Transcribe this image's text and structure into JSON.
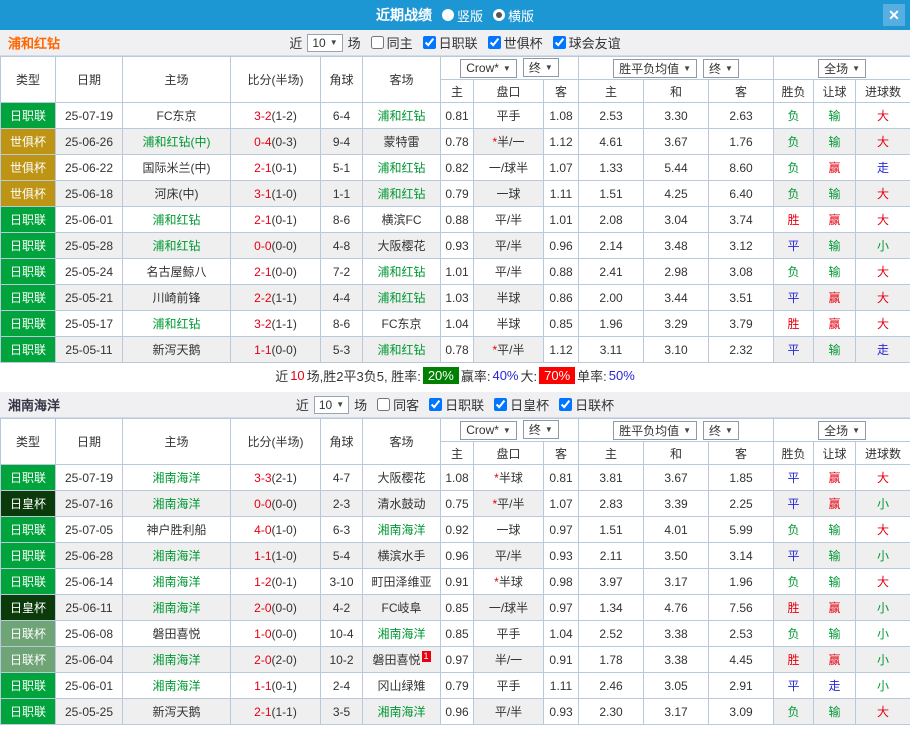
{
  "titlebar": {
    "title": "近期战绩",
    "radios": [
      {
        "label": "竖版",
        "selected": false
      },
      {
        "label": "横版",
        "selected": true
      }
    ],
    "close_icon": "✕"
  },
  "league_colors": {
    "日职联": "#00a33c",
    "世俱杯": "#bd9414",
    "日皇杯": "#0b3b0b",
    "日联杯": "#6fa477"
  },
  "columns": {
    "main": [
      "类型",
      "日期",
      "主场",
      "比分(半场)",
      "角球",
      "客场"
    ],
    "sub": [
      "主",
      "盘口",
      "客",
      "主",
      "和",
      "客",
      "胜负",
      "让球",
      "进球数"
    ],
    "selects": {
      "bookmaker": "Crow*",
      "final1": "终",
      "odds_avg": "胜平负均值",
      "final2": "终",
      "scope": "全场"
    }
  },
  "tables": [
    {
      "team": "浦和红钻",
      "team_color": "#ff6600",
      "filter": {
        "prefix": "近",
        "count": "10",
        "suffix": "场",
        "same_label": "同主",
        "same_checked": false,
        "leagues": [
          {
            "label": "日职联",
            "checked": true
          },
          {
            "label": "世俱杯",
            "checked": true
          },
          {
            "label": "球会友谊",
            "checked": true
          }
        ]
      },
      "rows": [
        {
          "league": "日职联",
          "date": "25-07-19",
          "home": "FC东京",
          "home_hl": false,
          "score": "3-2",
          "half": "(1-2)",
          "corner": "6-4",
          "away": "浦和红钻",
          "away_hl": true,
          "away_sup": "",
          "asia": [
            "0.81",
            "平手",
            "1.08"
          ],
          "europe": [
            "2.53",
            "3.30",
            "2.63"
          ],
          "results": [
            "负",
            "输",
            "大"
          ]
        },
        {
          "league": "世俱杯",
          "date": "25-06-26",
          "home": "浦和红钻(中)",
          "home_hl": true,
          "score": "0-4",
          "half": "(0-3)",
          "corner": "9-4",
          "away": "蒙特雷",
          "away_hl": false,
          "away_sup": "",
          "asia": [
            "0.78",
            "*半/一",
            "1.12"
          ],
          "europe": [
            "4.61",
            "3.67",
            "1.76"
          ],
          "results": [
            "负",
            "输",
            "大"
          ]
        },
        {
          "league": "世俱杯",
          "date": "25-06-22",
          "home": "国际米兰(中)",
          "home_hl": false,
          "score": "2-1",
          "half": "(0-1)",
          "corner": "5-1",
          "away": "浦和红钻",
          "away_hl": true,
          "away_sup": "",
          "asia": [
            "0.82",
            "一/球半",
            "1.07"
          ],
          "europe": [
            "1.33",
            "5.44",
            "8.60"
          ],
          "results": [
            "负",
            "赢",
            "走"
          ]
        },
        {
          "league": "世俱杯",
          "date": "25-06-18",
          "home": "河床(中)",
          "home_hl": false,
          "score": "3-1",
          "half": "(1-0)",
          "corner": "1-1",
          "away": "浦和红钻",
          "away_hl": true,
          "away_sup": "",
          "asia": [
            "0.79",
            "一球",
            "1.11"
          ],
          "europe": [
            "1.51",
            "4.25",
            "6.40"
          ],
          "results": [
            "负",
            "输",
            "大"
          ]
        },
        {
          "league": "日职联",
          "date": "25-06-01",
          "home": "浦和红钻",
          "home_hl": true,
          "score": "2-1",
          "half": "(0-1)",
          "corner": "8-6",
          "away": "横滨FC",
          "away_hl": false,
          "away_sup": "",
          "asia": [
            "0.88",
            "平/半",
            "1.01"
          ],
          "europe": [
            "2.08",
            "3.04",
            "3.74"
          ],
          "results": [
            "胜",
            "赢",
            "大"
          ]
        },
        {
          "league": "日职联",
          "date": "25-05-28",
          "home": "浦和红钻",
          "home_hl": true,
          "score": "0-0",
          "half": "(0-0)",
          "corner": "4-8",
          "away": "大阪樱花",
          "away_hl": false,
          "away_sup": "",
          "asia": [
            "0.93",
            "平/半",
            "0.96"
          ],
          "europe": [
            "2.14",
            "3.48",
            "3.12"
          ],
          "results": [
            "平",
            "输",
            "小"
          ]
        },
        {
          "league": "日职联",
          "date": "25-05-24",
          "home": "名古屋鲸八",
          "home_hl": false,
          "score": "2-1",
          "half": "(0-0)",
          "corner": "7-2",
          "away": "浦和红钻",
          "away_hl": true,
          "away_sup": "",
          "asia": [
            "1.01",
            "平/半",
            "0.88"
          ],
          "europe": [
            "2.41",
            "2.98",
            "3.08"
          ],
          "results": [
            "负",
            "输",
            "大"
          ]
        },
        {
          "league": "日职联",
          "date": "25-05-21",
          "home": "川崎前锋",
          "home_hl": false,
          "score": "2-2",
          "half": "(1-1)",
          "corner": "4-4",
          "away": "浦和红钻",
          "away_hl": true,
          "away_sup": "",
          "asia": [
            "1.03",
            "半球",
            "0.86"
          ],
          "europe": [
            "2.00",
            "3.44",
            "3.51"
          ],
          "results": [
            "平",
            "赢",
            "大"
          ]
        },
        {
          "league": "日职联",
          "date": "25-05-17",
          "home": "浦和红钻",
          "home_hl": true,
          "score": "3-2",
          "half": "(1-1)",
          "corner": "8-6",
          "away": "FC东京",
          "away_hl": false,
          "away_sup": "",
          "asia": [
            "1.04",
            "半球",
            "0.85"
          ],
          "europe": [
            "1.96",
            "3.29",
            "3.79"
          ],
          "results": [
            "胜",
            "赢",
            "大"
          ]
        },
        {
          "league": "日职联",
          "date": "25-05-11",
          "home": "新泻天鹅",
          "home_hl": false,
          "score": "1-1",
          "half": "(0-0)",
          "corner": "5-3",
          "away": "浦和红钻",
          "away_hl": true,
          "away_sup": "",
          "asia": [
            "0.78",
            "*平/半",
            "1.12"
          ],
          "europe": [
            "3.11",
            "3.10",
            "2.32"
          ],
          "results": [
            "平",
            "输",
            "走"
          ]
        }
      ],
      "summary": {
        "seg1": "近",
        "seg2": "10",
        "seg3": "场,胜2平3负5, 胜率:",
        "win_rate": "20%",
        "seg4": "赢率:",
        "win_pct": "40%",
        "seg5": "大:",
        "big_pct": "70%",
        "seg6": "单率:",
        "single_pct": "50%"
      }
    },
    {
      "team": "湘南海洋",
      "team_color": "#333344",
      "filter": {
        "prefix": "近",
        "count": "10",
        "suffix": "场",
        "same_label": "同客",
        "same_checked": false,
        "leagues": [
          {
            "label": "日职联",
            "checked": true
          },
          {
            "label": "日皇杯",
            "checked": true
          },
          {
            "label": "日联杯",
            "checked": true
          }
        ]
      },
      "rows": [
        {
          "league": "日职联",
          "date": "25-07-19",
          "home": "湘南海洋",
          "home_hl": true,
          "score": "3-3",
          "half": "(2-1)",
          "corner": "4-7",
          "away": "大阪樱花",
          "away_hl": false,
          "away_sup": "",
          "asia": [
            "1.08",
            "*半球",
            "0.81"
          ],
          "europe": [
            "3.81",
            "3.67",
            "1.85"
          ],
          "results": [
            "平",
            "赢",
            "大"
          ]
        },
        {
          "league": "日皇杯",
          "date": "25-07-16",
          "home": "湘南海洋",
          "home_hl": true,
          "score": "0-0",
          "half": "(0-0)",
          "corner": "2-3",
          "away": "清水鼓动",
          "away_hl": false,
          "away_sup": "",
          "asia": [
            "0.75",
            "*平/半",
            "1.07"
          ],
          "europe": [
            "2.83",
            "3.39",
            "2.25"
          ],
          "results": [
            "平",
            "赢",
            "小"
          ]
        },
        {
          "league": "日职联",
          "date": "25-07-05",
          "home": "神户胜利船",
          "home_hl": false,
          "score": "4-0",
          "half": "(1-0)",
          "corner": "6-3",
          "away": "湘南海洋",
          "away_hl": true,
          "away_sup": "",
          "asia": [
            "0.92",
            "一球",
            "0.97"
          ],
          "europe": [
            "1.51",
            "4.01",
            "5.99"
          ],
          "results": [
            "负",
            "输",
            "大"
          ]
        },
        {
          "league": "日职联",
          "date": "25-06-28",
          "home": "湘南海洋",
          "home_hl": true,
          "score": "1-1",
          "half": "(1-0)",
          "corner": "5-4",
          "away": "横滨水手",
          "away_hl": false,
          "away_sup": "",
          "asia": [
            "0.96",
            "平/半",
            "0.93"
          ],
          "europe": [
            "2.11",
            "3.50",
            "3.14"
          ],
          "results": [
            "平",
            "输",
            "小"
          ]
        },
        {
          "league": "日职联",
          "date": "25-06-14",
          "home": "湘南海洋",
          "home_hl": true,
          "score": "1-2",
          "half": "(0-1)",
          "corner": "3-10",
          "away": "町田泽维亚",
          "away_hl": false,
          "away_sup": "",
          "asia": [
            "0.91",
            "*半球",
            "0.98"
          ],
          "europe": [
            "3.97",
            "3.17",
            "1.96"
          ],
          "results": [
            "负",
            "输",
            "大"
          ]
        },
        {
          "league": "日皇杯",
          "date": "25-06-11",
          "home": "湘南海洋",
          "home_hl": true,
          "score": "2-0",
          "half": "(0-0)",
          "corner": "4-2",
          "away": "FC岐阜",
          "away_hl": false,
          "away_sup": "",
          "asia": [
            "0.85",
            "一/球半",
            "0.97"
          ],
          "europe": [
            "1.34",
            "4.76",
            "7.56"
          ],
          "results": [
            "胜",
            "赢",
            "小"
          ]
        },
        {
          "league": "日联杯",
          "date": "25-06-08",
          "home": "磐田喜悦",
          "home_hl": false,
          "score": "1-0",
          "half": "(0-0)",
          "corner": "10-4",
          "away": "湘南海洋",
          "away_hl": true,
          "away_sup": "",
          "asia": [
            "0.85",
            "平手",
            "1.04"
          ],
          "europe": [
            "2.52",
            "3.38",
            "2.53"
          ],
          "results": [
            "负",
            "输",
            "小"
          ]
        },
        {
          "league": "日联杯",
          "date": "25-06-04",
          "home": "湘南海洋",
          "home_hl": true,
          "score": "2-0",
          "half": "(2-0)",
          "corner": "10-2",
          "away": "磐田喜悦",
          "away_hl": false,
          "away_sup": "1",
          "asia": [
            "0.97",
            "半/一",
            "0.91"
          ],
          "europe": [
            "1.78",
            "3.38",
            "4.45"
          ],
          "results": [
            "胜",
            "赢",
            "小"
          ]
        },
        {
          "league": "日职联",
          "date": "25-06-01",
          "home": "湘南海洋",
          "home_hl": true,
          "score": "1-1",
          "half": "(0-1)",
          "corner": "2-4",
          "away": "冈山绿雉",
          "away_hl": false,
          "away_sup": "",
          "asia": [
            "0.79",
            "平手",
            "1.11"
          ],
          "europe": [
            "2.46",
            "3.05",
            "2.91"
          ],
          "results": [
            "平",
            "走",
            "小"
          ]
        },
        {
          "league": "日职联",
          "date": "25-05-25",
          "home": "新泻天鹅",
          "home_hl": false,
          "score": "2-1",
          "half": "(1-1)",
          "corner": "3-5",
          "away": "湘南海洋",
          "away_hl": true,
          "away_sup": "",
          "asia": [
            "0.96",
            "平/半",
            "0.93"
          ],
          "europe": [
            "2.30",
            "3.17",
            "3.09"
          ],
          "results": [
            "负",
            "输",
            "大"
          ]
        }
      ],
      "summary": null
    }
  ]
}
